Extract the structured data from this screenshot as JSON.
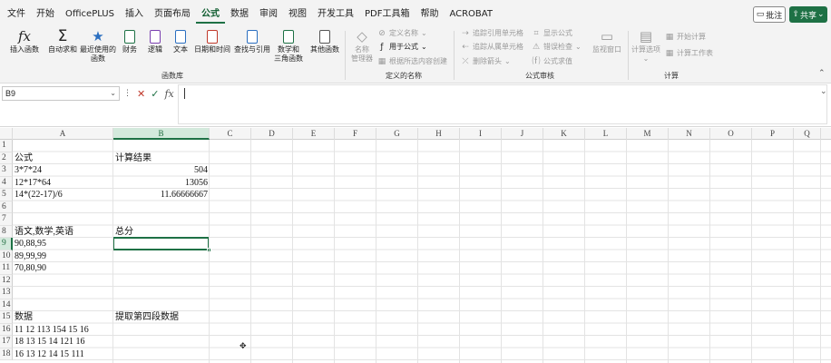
{
  "menu": {
    "tabs": [
      "文件",
      "开始",
      "OfficePLUS",
      "插入",
      "页面布局",
      "公式",
      "数据",
      "审阅",
      "视图",
      "开发工具",
      "PDF工具箱",
      "帮助",
      "ACROBAT"
    ],
    "active_tab": "公式",
    "comment_label": "批注",
    "share_label": "共享"
  },
  "ribbon": {
    "function_library": {
      "label": "函数库",
      "buttons": [
        {
          "line1": "插入函数",
          "line2": ""
        },
        {
          "line1": "自动求和",
          "line2": ""
        },
        {
          "line1": "最近使用的",
          "line2": "函数"
        },
        {
          "line1": "财务",
          "line2": ""
        },
        {
          "line1": "逻辑",
          "line2": ""
        },
        {
          "line1": "文本",
          "line2": ""
        },
        {
          "line1": "日期和时间",
          "line2": ""
        },
        {
          "line1": "查找与引用",
          "line2": ""
        },
        {
          "line1": "数学和",
          "line2": "三角函数"
        },
        {
          "line1": "其他函数",
          "line2": ""
        }
      ]
    },
    "defined_names": {
      "label": "定义的名称",
      "name_manager_line1": "名称",
      "name_manager_line2": "管理器",
      "items": [
        "定义名称",
        "用于公式",
        "根据所选内容创建"
      ]
    },
    "formula_auditing": {
      "label": "公式审核",
      "items": [
        "追踪引用单元格",
        "追踪从属单元格",
        "删除箭头",
        "显示公式",
        "错误检查",
        "公式求值"
      ],
      "watch_window": "监视窗口"
    },
    "calculation": {
      "label": "计算",
      "options_line1": "计算选项",
      "items": [
        "开始计算",
        "计算工作表"
      ]
    }
  },
  "formula_bar": {
    "name_box": "B9",
    "content": ""
  },
  "sheet": {
    "columns": [
      "A",
      "B",
      "C",
      "D",
      "E",
      "F",
      "G",
      "H",
      "I",
      "J",
      "K",
      "L",
      "M",
      "N",
      "O",
      "P",
      "Q"
    ],
    "selected_column": "B",
    "rows": [
      "1",
      "2",
      "3",
      "4",
      "5",
      "6",
      "7",
      "8",
      "9",
      "10",
      "11",
      "12",
      "13",
      "14",
      "15",
      "16",
      "17",
      "18"
    ],
    "selected_row": "9",
    "cells": {
      "A2": "公式",
      "B2": "计算结果",
      "A3": "3*7*24",
      "B3": "504",
      "A4": "12*17*64",
      "B4": "13056",
      "A5": "14*(22-17)/6",
      "B5": "11.66666667",
      "A8": "语文,数学,英语",
      "B8": "总分",
      "A9": "90,88,95",
      "A10": "89,99,99",
      "A11": "70,80,90",
      "A15": "数据",
      "B15": "提取第四段数据",
      "A16": "11 12 113 154 15 16",
      "A17": "18 13 15 14 121 16",
      "A18": "16 13 12 14 15 111"
    }
  }
}
